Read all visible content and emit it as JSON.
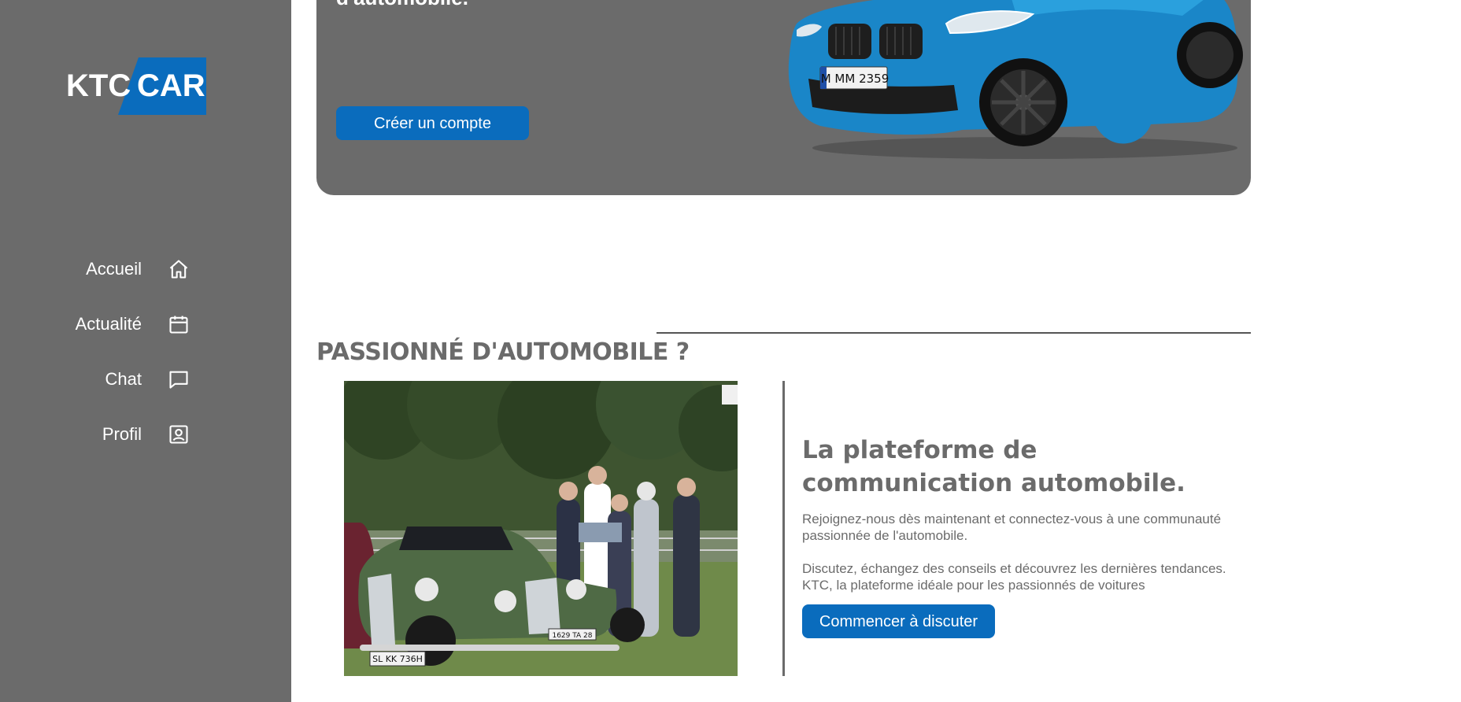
{
  "sidebar": {
    "logo": {
      "left_text": "KTC",
      "right_text": "CAR"
    },
    "items": [
      {
        "label": "Accueil",
        "icon": "home-icon"
      },
      {
        "label": "Actualité",
        "icon": "calendar-icon"
      },
      {
        "label": "Chat",
        "icon": "chat-bubble-icon"
      },
      {
        "label": "Profil",
        "icon": "profile-icon"
      }
    ]
  },
  "hero": {
    "title_partial": "d'automobile.",
    "cta_label": "Créer un compte",
    "car_plate": "M MM 2359"
  },
  "section": {
    "title": "PASSIONNÉ D'AUTOMOBILE ?",
    "heading": "La plateforme de communication automobile.",
    "paragraph1": "Rejoignez-nous dès maintenant et connectez-vous à une communauté passionnée de l'automobile.",
    "paragraph2": "Discutez, échangez des conseils et découvrez les dernières tendances. KTC, la plateforme idéale pour les passionnés de voitures",
    "cta_label": "Commencer à discuter",
    "photo_plate_1": "SL KK 736H",
    "photo_plate_2": "1629 TA 28"
  },
  "colors": {
    "sidebar_bg": "#6b6b6b",
    "accent": "#0a6cbd",
    "text_gray": "#6b6b6b"
  }
}
